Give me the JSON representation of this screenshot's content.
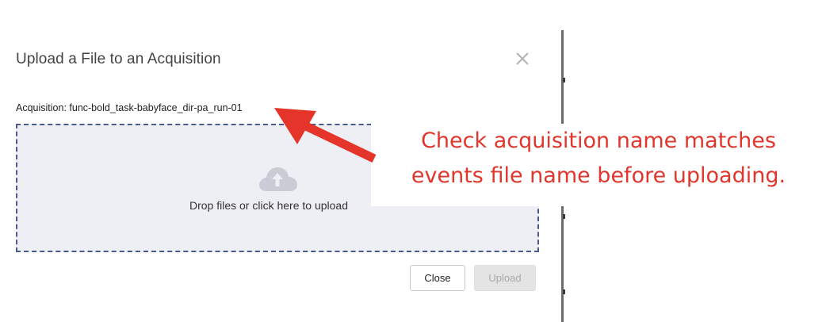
{
  "dialog": {
    "title": "Upload a File to an Acquisition",
    "close_symbol": "×",
    "acquisition_line": "Acquisition: func-bold_task-babyface_dir-pa_run-01",
    "dropzone": {
      "icon": "cloud-upload-icon",
      "text": "Drop files or click here to upload"
    },
    "buttons": {
      "close_label": "Close",
      "upload_label": "Upload",
      "upload_disabled": true
    }
  },
  "annotation": {
    "line1": "Check acquisition name matches",
    "line2": "events file name before uploading.",
    "color": "#e0362d",
    "arrow_icon": "red-arrow-icon"
  },
  "colors": {
    "dropzone_bg": "#eeeff4",
    "dropzone_border": "#4a5a8c",
    "title_text": "#444444"
  }
}
